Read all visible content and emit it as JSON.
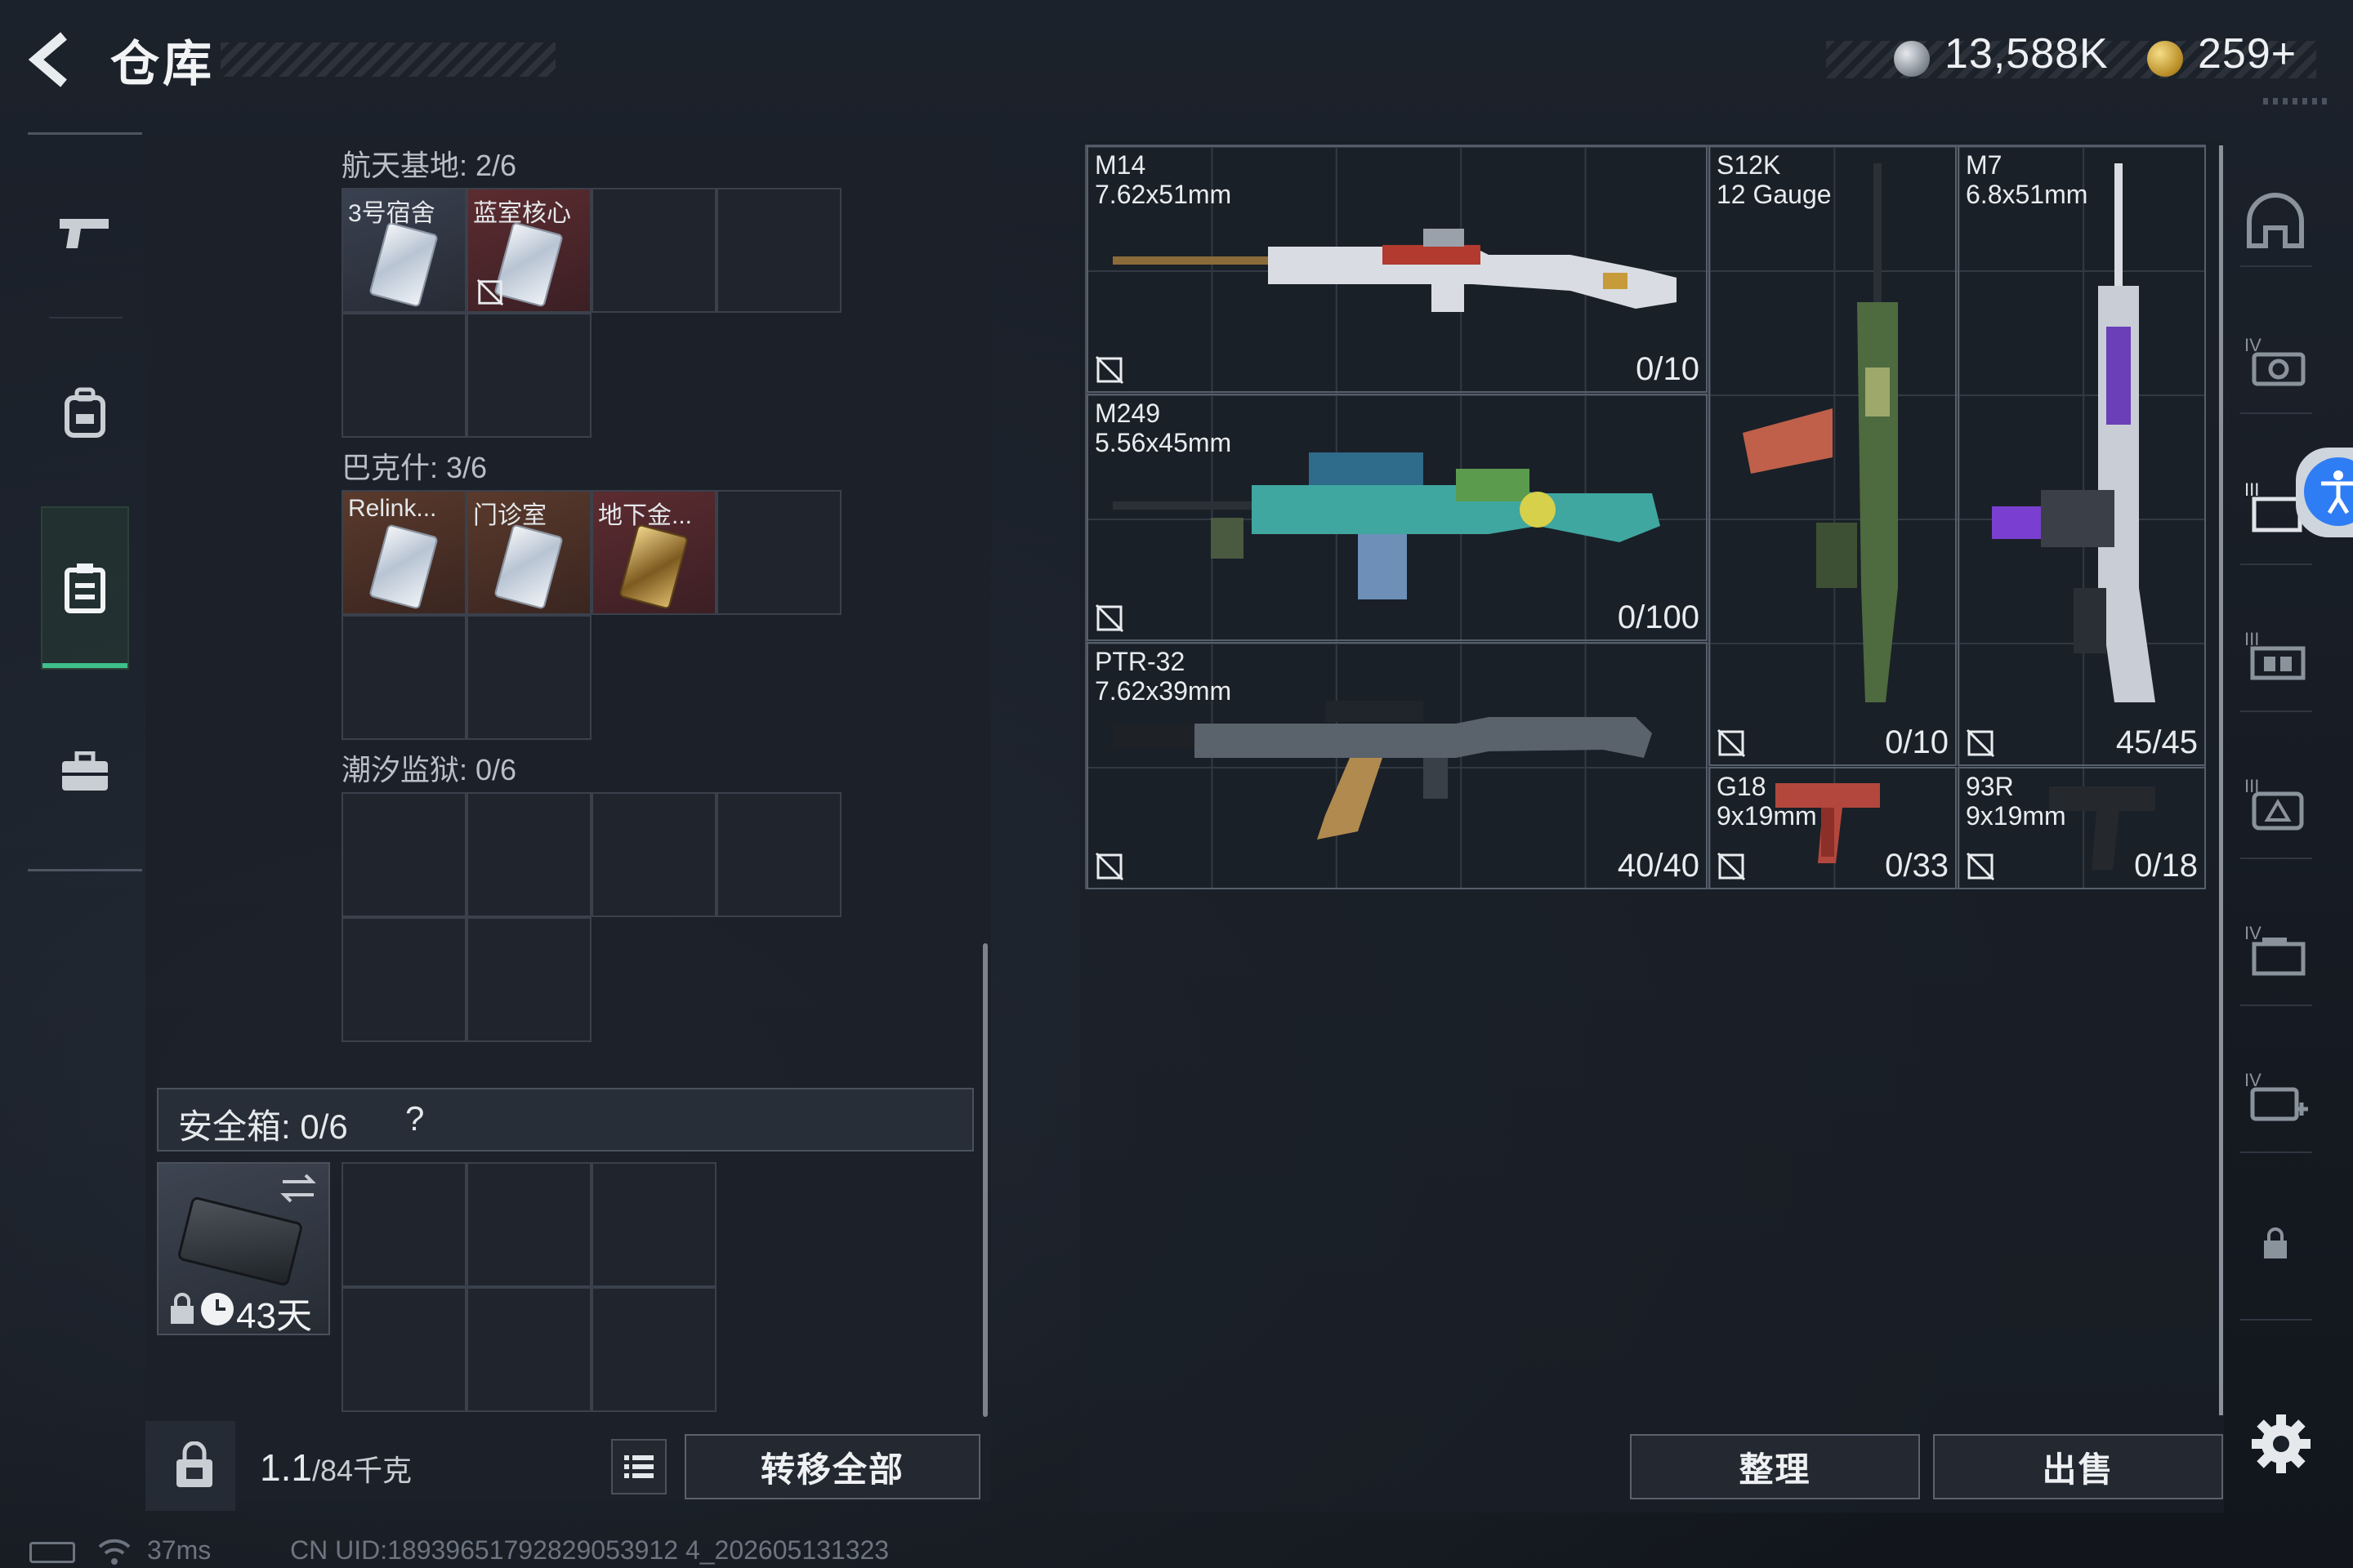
{
  "header": {
    "title": "仓库",
    "currency_silver": "13,588K",
    "currency_gold": "259+"
  },
  "left_nav": {
    "items": [
      {
        "id": "weapons",
        "icon": "pistol-icon"
      },
      {
        "id": "gear",
        "icon": "backpack-icon"
      },
      {
        "id": "storage",
        "icon": "clipboard-icon",
        "active": true
      },
      {
        "id": "case",
        "icon": "briefcase-icon"
      }
    ]
  },
  "sections": [
    {
      "label": "航天基地: 2/6",
      "items": [
        {
          "label": "3号宿舍",
          "style": "silver"
        },
        {
          "label": "蓝室核心",
          "style": "silver",
          "red": true,
          "no_swap": true
        }
      ]
    },
    {
      "label": "巴克什: 3/6",
      "items": [
        {
          "label": "Relink...",
          "style": "silver"
        },
        {
          "label": "门诊室",
          "style": "silver"
        },
        {
          "label": "地下金...",
          "style": "gold"
        }
      ]
    },
    {
      "label": "潮汐监狱: 0/6",
      "items": []
    }
  ],
  "safe_box": {
    "label": "安全箱: 0/6",
    "help": "?",
    "days": "43天"
  },
  "weight": {
    "current": "1.1",
    "max": "/84千克"
  },
  "buttons": {
    "transfer_all": "转移全部",
    "sort": "整理",
    "sell": "出售"
  },
  "weapons": [
    {
      "name": "M14",
      "caliber": "7.62x51mm",
      "ammo": "0/10"
    },
    {
      "name": "M249",
      "caliber": "5.56x45mm",
      "ammo": "0/100"
    },
    {
      "name": "PTR-32",
      "caliber": "7.62x39mm",
      "ammo": "40/40"
    },
    {
      "name": "S12K",
      "caliber": "12 Gauge",
      "ammo": "0/10"
    },
    {
      "name": "M7",
      "caliber": "6.8x51mm",
      "ammo": "45/45"
    },
    {
      "name": "G18",
      "caliber": "9x19mm",
      "ammo": "0/33"
    },
    {
      "name": "93R",
      "caliber": "9x19mm",
      "ammo": "0/18"
    }
  ],
  "status": {
    "ping": "37ms",
    "uid": "CN UID:18939651792829053912 4_202605131323"
  },
  "colors": {
    "accent_green": "#3fc08c",
    "accessibility_blue": "#2f7df4",
    "item_red_bg": "#5c2c30"
  }
}
